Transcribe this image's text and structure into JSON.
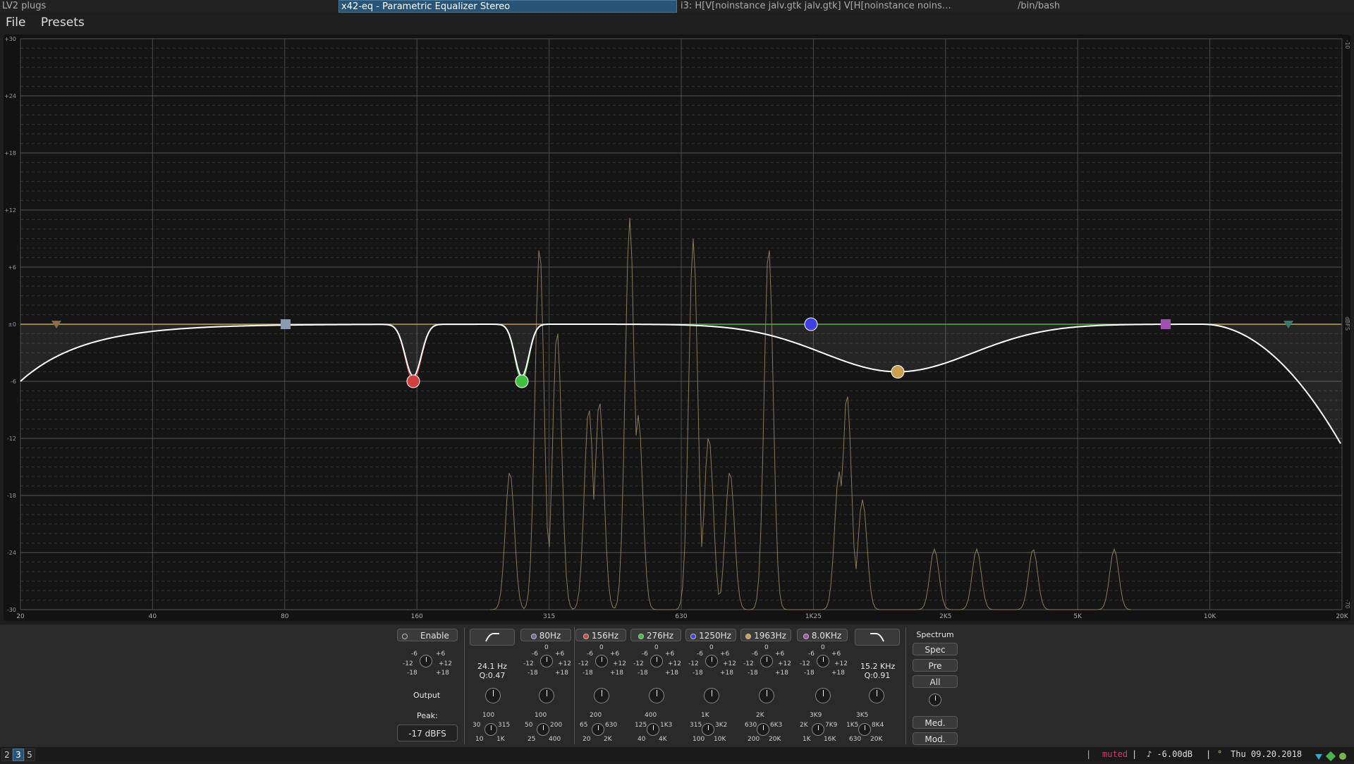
{
  "titlebar": {
    "left": "LV2 plugs",
    "active": "x42-eq - Parametric Equalizer Stereo",
    "middle": "i3: H[V[noinstance jalv.gtk jalv.gtk] V[H[noinstance noins…",
    "right": "/bin/bash"
  },
  "menu": {
    "file": "File",
    "presets": "Presets"
  },
  "graph": {
    "y_labels": [
      "+30",
      "+24",
      "+18",
      "+12",
      "+6",
      "±0",
      "-6",
      "-12",
      "-18",
      "-24",
      "-30"
    ],
    "x_labels": [
      "20",
      "40",
      "80",
      "160",
      "315",
      "630",
      "1K25",
      "2K5",
      "5K",
      "10K",
      "20K"
    ],
    "right_labels": {
      "top": "-10",
      "mid": "dBFS",
      "bottom": "-70"
    },
    "colors": {
      "response": "#ffffff",
      "band1": "#d04040",
      "band2": "#40c040",
      "band3": "#4040e0",
      "band4": "#c8a050",
      "band5": "#a050b0",
      "spectrum": "#8a7a5a"
    }
  },
  "panel": {
    "enable": "Enable",
    "output": "Output",
    "peak_label": "Peak:",
    "peak_value": "-17 dBFS",
    "hp": {
      "freq": "24.1 Hz",
      "q": "Q:0.47"
    },
    "lp": {
      "freq": "15.2 KHz",
      "q": "Q:0.91"
    },
    "bands": [
      {
        "label": "80Hz",
        "color": "#6a6a9a"
      },
      {
        "label": "156Hz",
        "color": "#d04040"
      },
      {
        "label": "276Hz",
        "color": "#40c040"
      },
      {
        "label": "1250Hz",
        "color": "#4040e0"
      },
      {
        "label": "1963Hz",
        "color": "#c8a050"
      },
      {
        "label": "8.0KHz",
        "color": "#a050b0"
      }
    ],
    "gain_labels": {
      "m6": "-6",
      "p6": "+6",
      "m12": "-12",
      "p12": "+12",
      "m18": "-18",
      "p18": "+18",
      "zero": "0"
    },
    "freq_scales": [
      {
        "top": "100",
        "l1": "30",
        "r1": "315",
        "l2": "10",
        "r2": "1K"
      },
      {
        "top": "100",
        "l1": "50",
        "r1": "200",
        "l2": "25",
        "r2": "400"
      },
      {
        "top": "200",
        "l1": "65",
        "r1": "630",
        "l2": "20",
        "r2": "2K"
      },
      {
        "top": "400",
        "l1": "125",
        "r1": "1K3",
        "l2": "40",
        "r2": "4K"
      },
      {
        "top": "1K",
        "l1": "315",
        "r1": "3K2",
        "l2": "100",
        "r2": "10K"
      },
      {
        "top": "2K",
        "l1": "630",
        "r1": "6K3",
        "l2": "200",
        "r2": "20K"
      },
      {
        "top": "3K9",
        "l1": "2K",
        "r1": "7K9",
        "l2": "1K",
        "r2": "16K"
      },
      {
        "top": "3K5",
        "l1": "1K5",
        "r1": "8K4",
        "l2": "630",
        "r2": "20K"
      }
    ],
    "spectrum": {
      "title": "Spectrum",
      "spec": "Spec",
      "pre": "Pre",
      "all": "All",
      "med": "Med.",
      "mod": "Mod."
    }
  },
  "status": {
    "workspaces": [
      "2",
      "3",
      "5"
    ],
    "muted": "muted",
    "volume": "♪ -6.00dB",
    "date": "Thu 09.20.2018"
  }
}
